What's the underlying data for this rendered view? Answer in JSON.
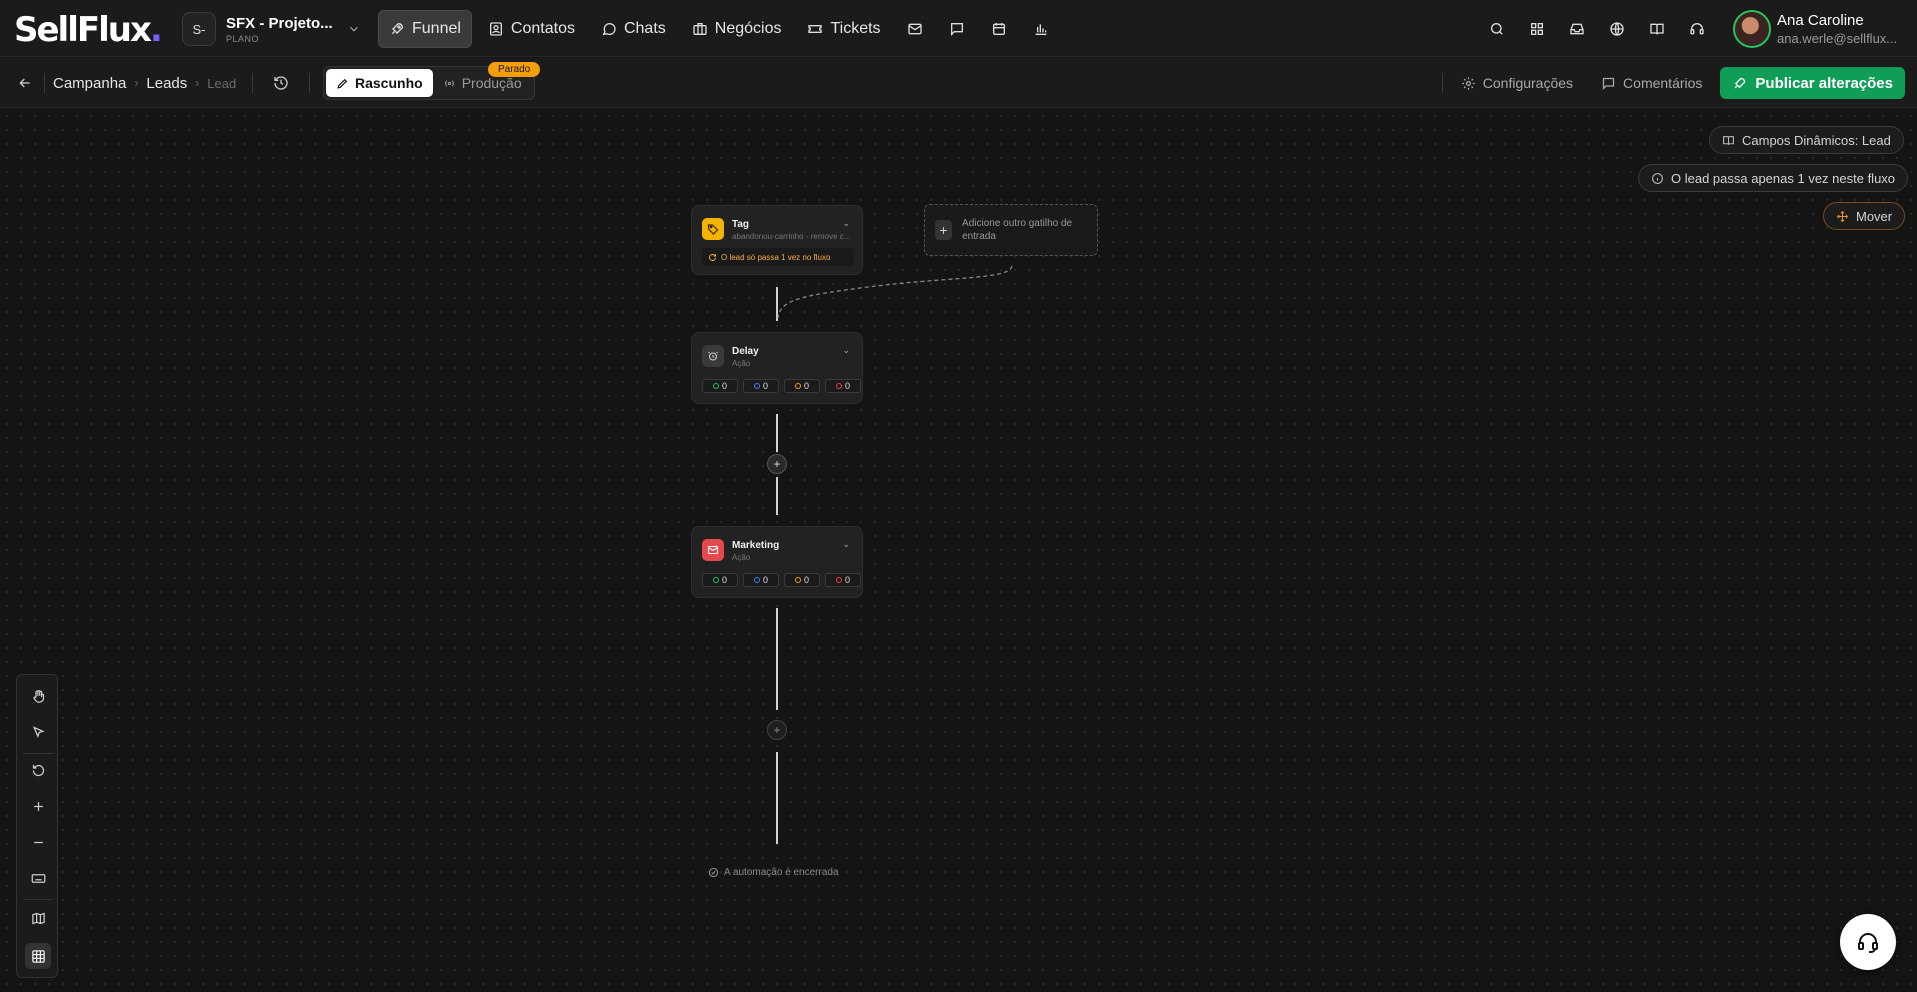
{
  "brand": {
    "logo_text": "SellFlux",
    "logo_dot": "."
  },
  "project": {
    "initial": "S-",
    "name": "SFX - Projeto...",
    "plan": "PLANO"
  },
  "nav": {
    "funnel": "Funnel",
    "contatos": "Contatos",
    "chats": "Chats",
    "negocios": "Negócios",
    "tickets": "Tickets"
  },
  "user": {
    "name": "Ana Caroline",
    "email": "ana.werle@sellflux..."
  },
  "breadcrumb": {
    "campanha": "Campanha",
    "leads": "Leads",
    "lead": "Lead"
  },
  "modes": {
    "rascunho": "Rascunho",
    "producao": "Produção",
    "status_badge": "Parado"
  },
  "actions": {
    "configuracoes": "Configurações",
    "comentarios": "Comentários",
    "publicar": "Publicar alterações"
  },
  "canvas": {
    "campos_dinamicos": "Campos Dinâmicos: Lead",
    "lead_info": "O lead passa apenas 1 vez neste fluxo",
    "mover": "Mover",
    "add_trigger": "Adicione outro gatilho de entrada",
    "end_text": "A automação é encerrada"
  },
  "nodes": {
    "tag": {
      "title": "Tag",
      "subtitle": "abandonou-carrinho - remove c...",
      "warning": "O lead só passa 1 vez no fluxo"
    },
    "delay": {
      "title": "Delay",
      "subtitle": "Ação",
      "stats": [
        "0",
        "0",
        "0",
        "0"
      ]
    },
    "marketing": {
      "title": "Marketing",
      "subtitle": "Ação",
      "stats": [
        "0",
        "0",
        "0",
        "0"
      ]
    }
  },
  "colors": {
    "accent_green": "#0f9d58",
    "badge_orange": "#f59e0b",
    "tag_yellow": "#f5b400",
    "marketing_red": "#e5484d",
    "brand_purple": "#7c5cff"
  }
}
